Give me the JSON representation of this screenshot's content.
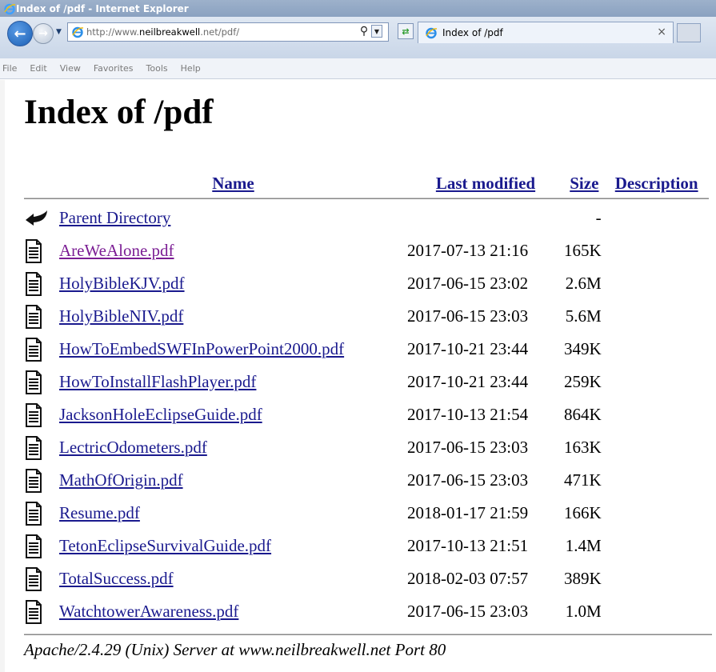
{
  "window": {
    "title": "Index of /pdf - Internet Explorer"
  },
  "navbar": {
    "back_icon": "back-arrow-icon",
    "forward_icon": "forward-arrow-icon",
    "url_prefix": "http://www.",
    "url_domain": "neilbreakwell",
    "url_suffix": ".net/pdf/",
    "search_icon": "search-icon",
    "refresh_icon": "refresh-icon",
    "tab_label": "Index of /pdf",
    "tab_close": "×"
  },
  "menubar": {
    "items": [
      "File",
      "Edit",
      "View",
      "Favorites",
      "Tools",
      "Help"
    ]
  },
  "page": {
    "heading": "Index of /pdf",
    "columns": {
      "name": "Name",
      "last_modified": "Last modified",
      "size": "Size",
      "description": "Description"
    },
    "parent": {
      "label": "Parent Directory",
      "size": "-"
    },
    "files": [
      {
        "name": "AreWeAlone.pdf",
        "date": "2017-07-13 21:16",
        "size": "165K",
        "visited": true
      },
      {
        "name": "HolyBibleKJV.pdf",
        "date": "2017-06-15 23:02",
        "size": "2.6M",
        "visited": false
      },
      {
        "name": "HolyBibleNIV.pdf",
        "date": "2017-06-15 23:03",
        "size": "5.6M",
        "visited": false
      },
      {
        "name": "HowToEmbedSWFInPowerPoint2000.pdf",
        "date": "2017-10-21 23:44",
        "size": "349K",
        "visited": false
      },
      {
        "name": "HowToInstallFlashPlayer.pdf",
        "date": "2017-10-21 23:44",
        "size": "259K",
        "visited": false
      },
      {
        "name": "JacksonHoleEclipseGuide.pdf",
        "date": "2017-10-13 21:54",
        "size": "864K",
        "visited": false
      },
      {
        "name": "LectricOdometers.pdf",
        "date": "2017-06-15 23:03",
        "size": "163K",
        "visited": false
      },
      {
        "name": "MathOfOrigin.pdf",
        "date": "2017-06-15 23:03",
        "size": "471K",
        "visited": false
      },
      {
        "name": "Resume.pdf",
        "date": "2018-01-17 21:59",
        "size": "166K",
        "visited": false
      },
      {
        "name": "TetonEclipseSurvivalGuide.pdf",
        "date": "2017-10-13 21:51",
        "size": "1.4M",
        "visited": false
      },
      {
        "name": "TotalSuccess.pdf",
        "date": "2018-02-03 07:57",
        "size": "389K",
        "visited": false
      },
      {
        "name": "WatchtowerAwareness.pdf",
        "date": "2017-06-15 23:03",
        "size": "1.0M",
        "visited": false
      }
    ],
    "footer": "Apache/2.4.29 (Unix) Server at www.neilbreakwell.net Port 80"
  },
  "colors": {
    "link": "#1a1a8e",
    "visited_link": "#7b1d94",
    "titlebar": "#8aa1c0"
  }
}
